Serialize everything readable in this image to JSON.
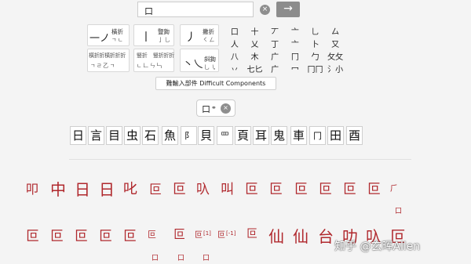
{
  "search": {
    "value": "口",
    "clear_icon": "×",
    "go_icon": "→"
  },
  "strokes": [
    {
      "glyph": "一ノ",
      "label": "橫折"
    },
    {
      "glyph": "丨",
      "label": "豎鉤"
    },
    {
      "glyph": "丿",
      "label": "撇折"
    },
    {
      "glyph": "丶乀",
      "label": "斜鉤"
    }
  ],
  "stroke_sub_labels": [
    "橫折折橫折折折",
    "豎折",
    "豎折折折"
  ],
  "components": [
    [
      "口",
      "十",
      "丆",
      "亠",
      "乚",
      "厶"
    ],
    [
      "人",
      "乂",
      "丁",
      "亠",
      "卜",
      "又"
    ],
    [
      "八",
      "木",
      "广",
      "冂",
      "勹",
      "攵攵"
    ],
    [
      "丷",
      "七匕",
      "广",
      "冖",
      "冂冂",
      "氵小"
    ]
  ],
  "difficult_label": "難輸入部件 Difficult Components",
  "selected_component": {
    "text": "口",
    "link_icon": "🔗",
    "clear_icon": "×"
  },
  "radicals": [
    "日",
    "言",
    "目",
    "虫",
    "石",
    "魚",
    "阝",
    "貝",
    "罒",
    "頁",
    "耳",
    "鬼",
    "車",
    "冂",
    "田",
    "酉"
  ],
  "results_row1": [
    "叩",
    "中",
    "日",
    "日",
    "叱",
    "叵",
    "叵",
    "叺",
    "叫",
    "叵",
    "叵",
    "叵",
    "叵",
    "叵",
    "叵"
  ],
  "results_row1_sub": "口",
  "results_row2": [
    "叵",
    "叵",
    "叵",
    "叵",
    "叵",
    "叵",
    "叵",
    "叵",
    "叵",
    "叵",
    "仙",
    "仙",
    "台",
    "叻",
    "叺",
    "叵"
  ],
  "results_row2_tags": [
    "[1]",
    "[-1]"
  ],
  "results_row2_sub": [
    "口",
    "口",
    "口"
  ],
  "watermark": "知乎 @玄晖Allen"
}
